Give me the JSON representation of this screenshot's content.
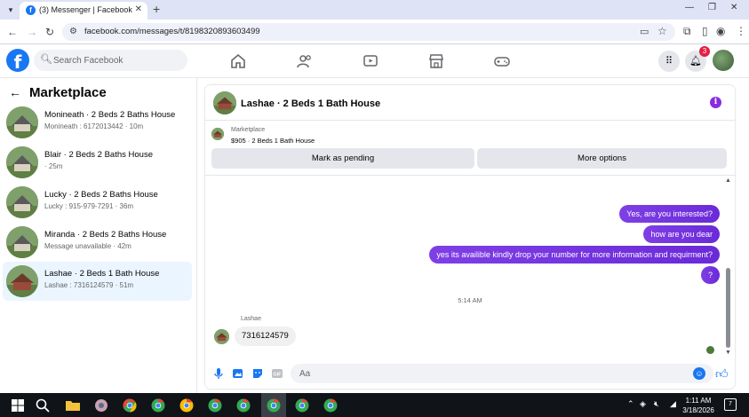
{
  "browser": {
    "tab_title": "(3) Messenger | Facebook",
    "url": "facebook.com/messages/t/8198320893603499"
  },
  "fb": {
    "logo": "f",
    "search_placeholder": "Search Facebook",
    "notification_count": "3"
  },
  "sidebar": {
    "title": "Marketplace",
    "threads": [
      {
        "name": "Monineath · 2 Beds 2 Baths House",
        "meta": "Monineath : 6172013442 · 10m"
      },
      {
        "name": "Blair · 2 Beds 2 Baths House",
        "meta": " · 25m"
      },
      {
        "name": "Lucky · 2 Beds 2 Baths House",
        "meta": "Lucky : 915-979-7291 · 36m"
      },
      {
        "name": "Miranda · 2 Beds 2 Baths House",
        "meta": "Message unavailable · 42m"
      },
      {
        "name": "Lashae · 2 Beds 1 Bath House",
        "meta": "Lashae : 7316124579 · 51m"
      }
    ]
  },
  "chat": {
    "title": "Lashae · 2 Beds 1 Bath House",
    "listing_label": "Marketplace",
    "listing_price": "$905 · 2 Beds 1 Bath House",
    "btn_pending": "Mark as pending",
    "btn_more": "More options",
    "outgoing": [
      "Yes, are you interested?",
      "how are you dear",
      "yes its availible kindly drop your number for more information and requirment?",
      "?"
    ],
    "timestamp": "5:14 AM",
    "sender": "Lashae",
    "incoming": "7316124579",
    "composer_placeholder": "Aa"
  },
  "taskbar": {
    "time": "1:11 AM",
    "date": "3/18/2026",
    "notif": "7"
  },
  "colors": {
    "fb_blue": "#1877f2",
    "bubble_purple": "#7f3fe6",
    "active_thread": "#ebf5ff"
  }
}
